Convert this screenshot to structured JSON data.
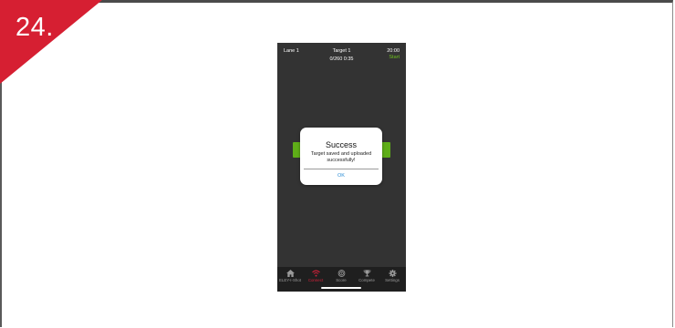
{
  "step": {
    "number": "24.",
    "color": "#d61f32"
  },
  "phone": {
    "header": {
      "lane": "Lane 1",
      "target_title": "Target 1",
      "target_time": "0/260 0:35",
      "clock": "20:00",
      "start_label": "Start"
    },
    "dialog": {
      "title": "Success",
      "message": "Target saved and uploaded successfully!",
      "ok_label": "OK"
    },
    "tabs": [
      {
        "label": "ELEY-I-Shot",
        "icon": "home-icon"
      },
      {
        "label": "Connect",
        "icon": "wifi-icon",
        "active": true
      },
      {
        "label": "Score",
        "icon": "target-icon"
      },
      {
        "label": "Compete",
        "icon": "trophy-icon"
      },
      {
        "label": "Settings",
        "icon": "gear-icon"
      }
    ],
    "colors": {
      "accent_green": "#5fae18",
      "active_tab": "#d4213a",
      "link_blue": "#2f8fd6"
    }
  }
}
